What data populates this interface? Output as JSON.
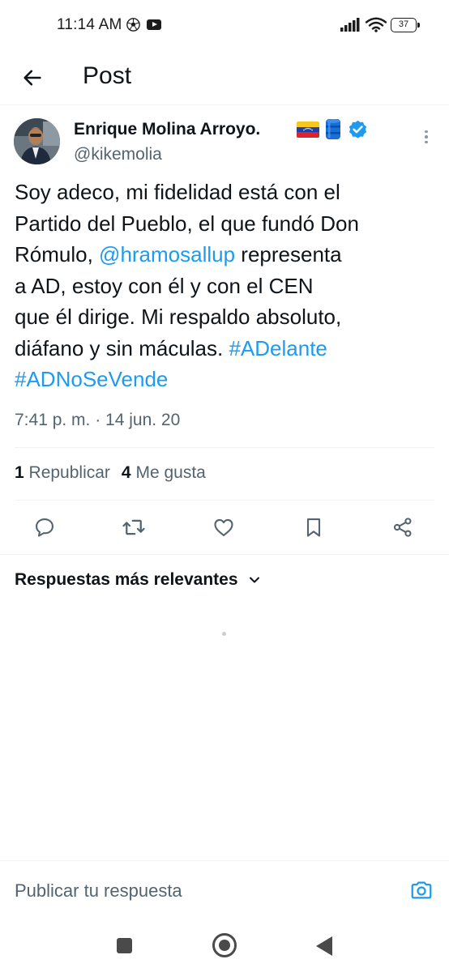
{
  "status_bar": {
    "time": "11:14 AM",
    "icons": [
      "soccer-ball-icon",
      "youtube-icon",
      "signal-icon",
      "wifi-icon",
      "battery-icon"
    ],
    "battery_level": "37"
  },
  "header": {
    "title": "Post",
    "back_icon": "arrow-left-icon"
  },
  "tweet": {
    "author_name": "Enrique Molina Arroyo.",
    "author_emojis": [
      "venezuela-flag-icon",
      "oil-barrel-icon"
    ],
    "verified_icon": "verified-badge-icon",
    "handle": "@kikemolia",
    "text_lines": [
      {
        "parts": [
          {
            "text": "Soy adeco, mi fidelidad está con el",
            "link": false
          }
        ]
      },
      {
        "parts": [
          {
            "text": "Partido del Pueblo, el que fundó Don",
            "link": false
          }
        ]
      },
      {
        "parts": [
          {
            "text": "Rómulo, ",
            "link": false
          },
          {
            "text": "@hramosallup",
            "link": true
          },
          {
            "text": " representa",
            "link": false
          }
        ]
      },
      {
        "parts": [
          {
            "text": "a AD, estoy con él y con el CEN",
            "link": false
          }
        ]
      },
      {
        "parts": [
          {
            "text": "que él dirige. Mi respaldo absoluto,",
            "link": false
          }
        ]
      },
      {
        "parts": [
          {
            "text": "diáfano y sin máculas. ",
            "link": false
          },
          {
            "text": "#ADelante",
            "link": true
          }
        ]
      },
      {
        "parts": [
          {
            "text": "#ADNoSeVende",
            "link": true
          }
        ]
      }
    ],
    "timestamp": "7:41 p. m. · 14 jun. 20",
    "stats": {
      "reposts_count": "1",
      "reposts_label": "Republicar",
      "likes_count": "4",
      "likes_label": "Me gusta"
    },
    "actions": [
      "reply-icon",
      "retweet-icon",
      "like-icon",
      "bookmark-icon",
      "share-icon"
    ]
  },
  "replies": {
    "sort_label": "Respuestas más relevantes",
    "sort_icon": "chevron-down-icon"
  },
  "reply_bar": {
    "placeholder": "Publicar tu respuesta",
    "camera_icon": "camera-icon"
  },
  "nav_bar": {
    "buttons": [
      "recents-button",
      "home-button",
      "back-button"
    ]
  },
  "colors": {
    "accent": "#1d9bf0",
    "text_primary": "#0f1419",
    "text_secondary": "#536471",
    "divider": "#eff3f4"
  }
}
